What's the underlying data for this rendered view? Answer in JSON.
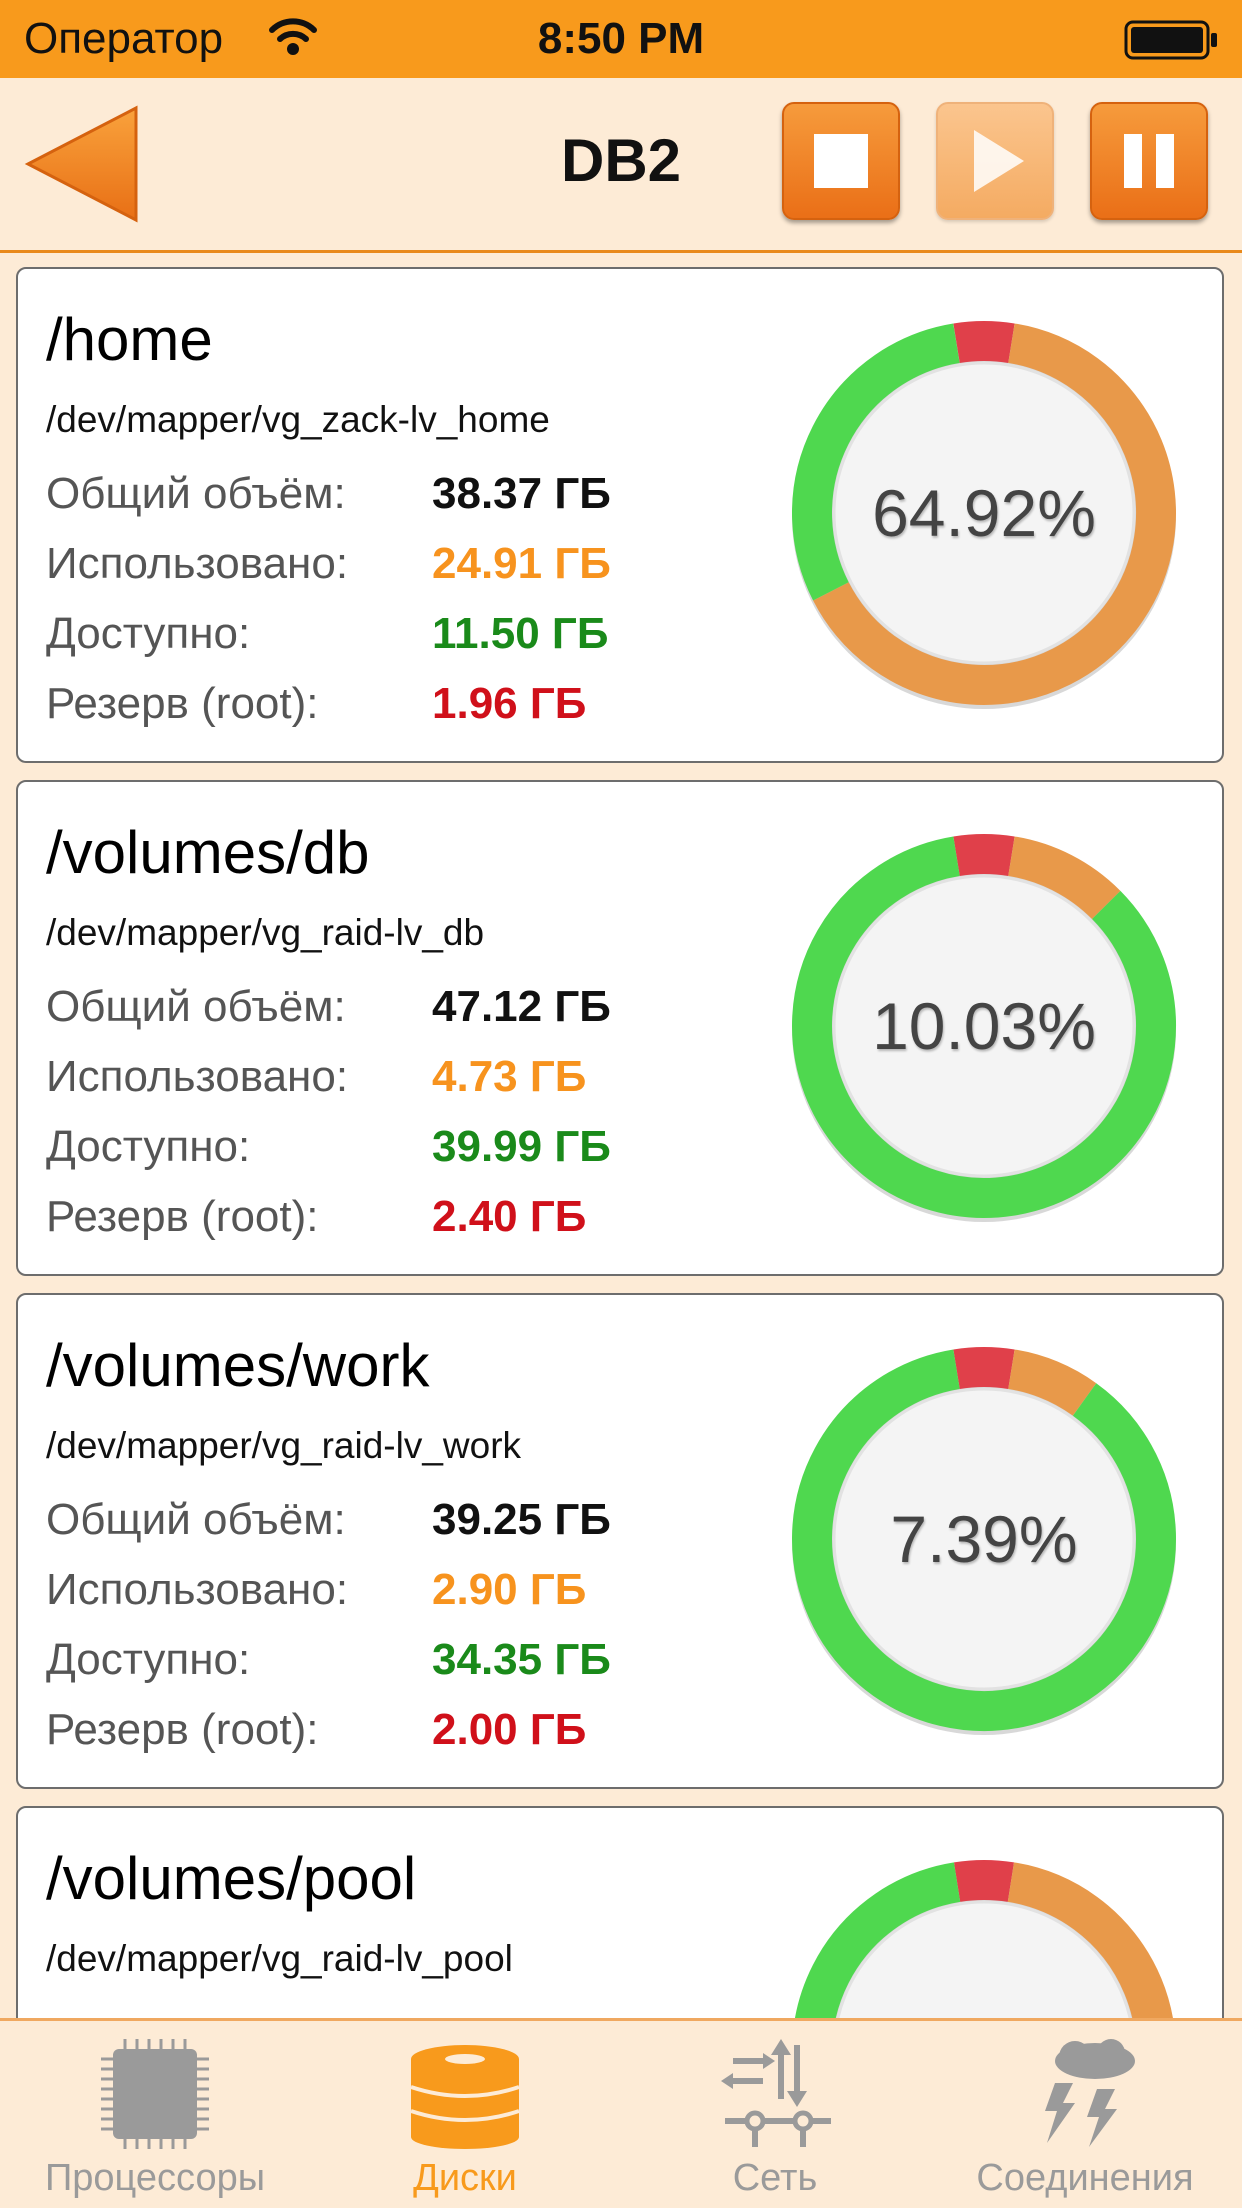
{
  "status_bar": {
    "carrier": "Оператор",
    "time": "8:50 PM"
  },
  "nav": {
    "title": "DB2"
  },
  "labels": {
    "total": "Общий объём:",
    "used": "Использовано:",
    "free": "Доступно:",
    "reserve": "Резерв (root):"
  },
  "disks": [
    {
      "mount": "/home",
      "device": "/dev/mapper/vg_zack-lv_home",
      "total": "38.37 ГБ",
      "used": "24.91 ГБ",
      "free": "11.50 ГБ",
      "reserve": "1.96 ГБ",
      "percent": "64.92%",
      "fractions": {
        "used": 0.6492,
        "reserve": 0.051,
        "free": 0.2997
      }
    },
    {
      "mount": "/volumes/db",
      "device": "/dev/mapper/vg_raid-lv_db",
      "total": "47.12 ГБ",
      "used": "4.73 ГБ",
      "free": "39.99 ГБ",
      "reserve": "2.40 ГБ",
      "percent": "10.03%",
      "fractions": {
        "used": 0.1003,
        "reserve": 0.051,
        "free": 0.8487
      }
    },
    {
      "mount": "/volumes/work",
      "device": "/dev/mapper/vg_raid-lv_work",
      "total": "39.25 ГБ",
      "used": "2.90 ГБ",
      "free": "34.35 ГБ",
      "reserve": "2.00 ГБ",
      "percent": "7.39%",
      "fractions": {
        "used": 0.0739,
        "reserve": 0.051,
        "free": 0.8751
      }
    },
    {
      "mount": "/volumes/pool",
      "device": "/dev/mapper/vg_raid-lv_pool",
      "fractions": {
        "used": 0.65,
        "reserve": 0.05,
        "free": 0.3
      }
    }
  ],
  "tabs": [
    {
      "label": "Процессоры",
      "icon": "cpu-chip-icon",
      "active": false
    },
    {
      "label": "Диски",
      "icon": "disk-stack-icon",
      "active": true
    },
    {
      "label": "Сеть",
      "icon": "network-icon",
      "active": false
    },
    {
      "label": "Соединения",
      "icon": "storm-cloud-icon",
      "active": false
    }
  ],
  "colors": {
    "accent": "#f89a1c",
    "used": "#e8994a",
    "free": "#4fd84f",
    "reserve": "#e0404a"
  }
}
